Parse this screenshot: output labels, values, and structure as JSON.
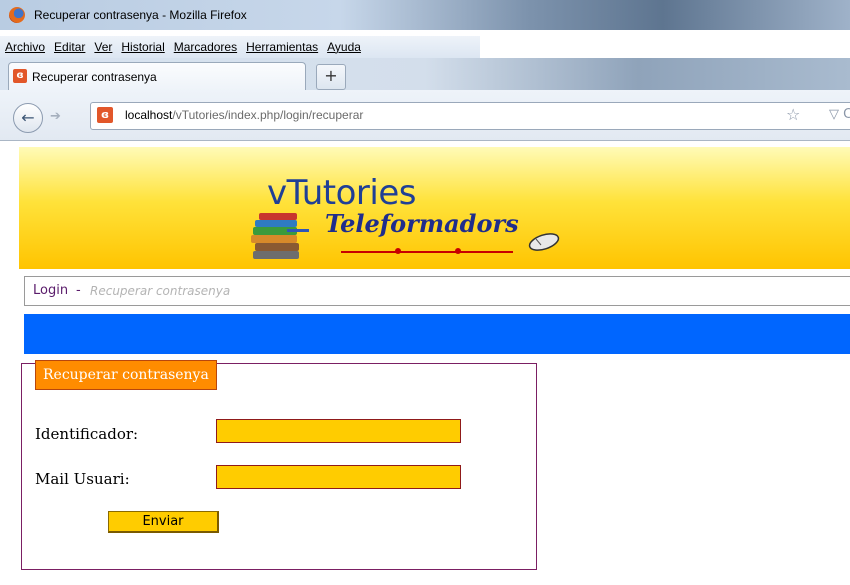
{
  "window": {
    "title": "Recuperar contrasenya - Mozilla Firefox"
  },
  "menu": {
    "items": [
      "Archivo",
      "Editar",
      "Ver",
      "Historial",
      "Marcadores",
      "Herramientas",
      "Ayuda"
    ]
  },
  "tab": {
    "label": "Recuperar contrasenya",
    "new_tab_label": "+"
  },
  "navigation": {
    "url_host": "localhost",
    "url_path": "/vTutories/index.php/login/recuperar",
    "back_glyph": "←",
    "forward_glyph": "➔"
  },
  "banner": {
    "name": "vTutories",
    "subtitle": "Teleformadors"
  },
  "breadcrumb": {
    "root": "Login",
    "separator": "-",
    "current": "Recuperar contrasenya"
  },
  "form": {
    "legend": "Recuperar contrasenya",
    "identifier_label": "Identificador:",
    "identifier_value": "",
    "email_label": "Mail Usuari:",
    "email_value": "",
    "submit_label": "Enviar"
  },
  "colors": {
    "banner_yellow": "#ffcc00",
    "blue_bar": "#0066ff",
    "legend_orange": "#ff8c00",
    "form_border": "#7b1f63",
    "input_fill": "#ffcc00"
  },
  "icons": {
    "browser": "firefox-icon",
    "favicon": "site-favicon",
    "bookmark": "star-icon",
    "reload": "reload-icon"
  }
}
